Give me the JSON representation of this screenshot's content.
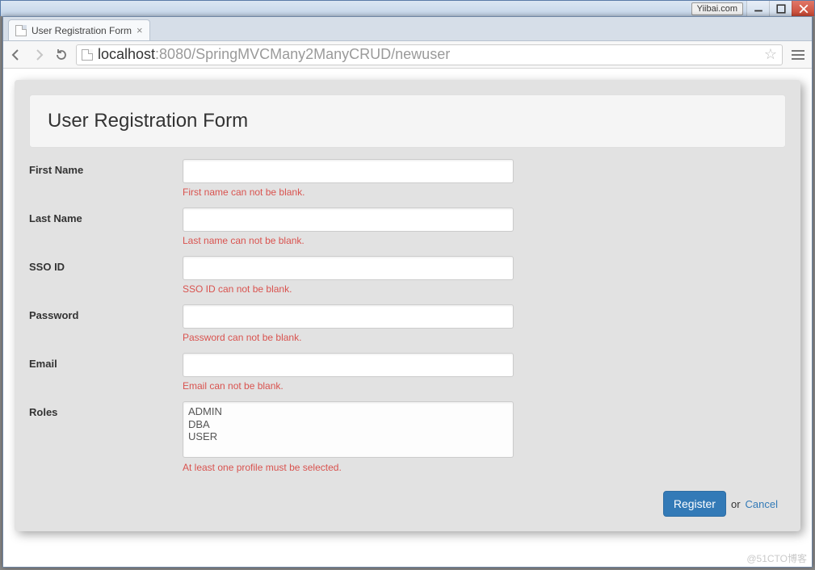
{
  "os": {
    "site_badge": "Yiibai.com"
  },
  "browser": {
    "tab_title": "User Registration Form",
    "url_host": "localhost",
    "url_port_path": ":8080/SpringMVCMany2ManyCRUD/newuser"
  },
  "page": {
    "heading": "User Registration Form",
    "fields": {
      "first_name": {
        "label": "First Name",
        "value": "",
        "error": "First name can not be blank."
      },
      "last_name": {
        "label": "Last Name",
        "value": "",
        "error": "Last name can not be blank."
      },
      "sso_id": {
        "label": "SSO ID",
        "value": "",
        "error": "SSO ID can not be blank."
      },
      "password": {
        "label": "Password",
        "value": "",
        "error": "Password can not be blank."
      },
      "email": {
        "label": "Email",
        "value": "",
        "error": "Email can not be blank."
      },
      "roles": {
        "label": "Roles",
        "options": [
          "ADMIN",
          "DBA",
          "USER"
        ],
        "error": "At least one profile must be selected."
      }
    },
    "actions": {
      "register_label": "Register",
      "or_label": "or",
      "cancel_label": "Cancel"
    }
  },
  "watermark": "@51CTO博客"
}
